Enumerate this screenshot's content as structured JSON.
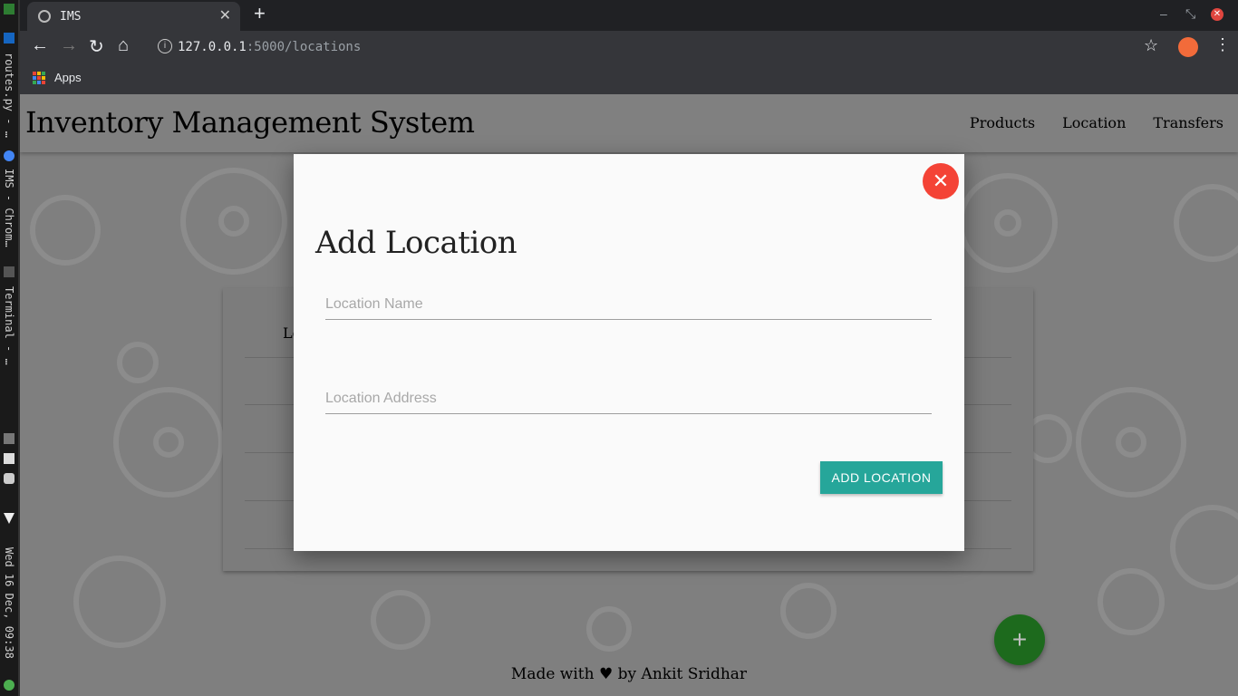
{
  "system_bar": {
    "window_1": "routes.py - …",
    "window_2": "IMS - Chrom…",
    "window_3": "Terminal - …",
    "clock": "Wed 16 Dec, 09:38"
  },
  "browser": {
    "tab_title": "IMS",
    "url_host": "127.0.0.1",
    "url_rest": ":5000/locations",
    "bookmark_apps": "Apps"
  },
  "site": {
    "brand": "Inventory Management System",
    "nav": [
      "Products",
      "Location",
      "Transfers"
    ],
    "table_header_partial": "Lo",
    "footer_prefix": "Made with",
    "footer_heart": "♥",
    "footer_suffix": "by Ankit Sridhar",
    "fab_symbol": "+"
  },
  "modal": {
    "title": "Add Location",
    "close_symbol": "✕",
    "name_placeholder": "Location Name",
    "address_placeholder": "Location Address",
    "submit_label": "ADD LOCATION"
  },
  "colors": {
    "accent_teal": "#26a69a",
    "close_red": "#f44336",
    "fab_green": "#1d6a1d"
  }
}
